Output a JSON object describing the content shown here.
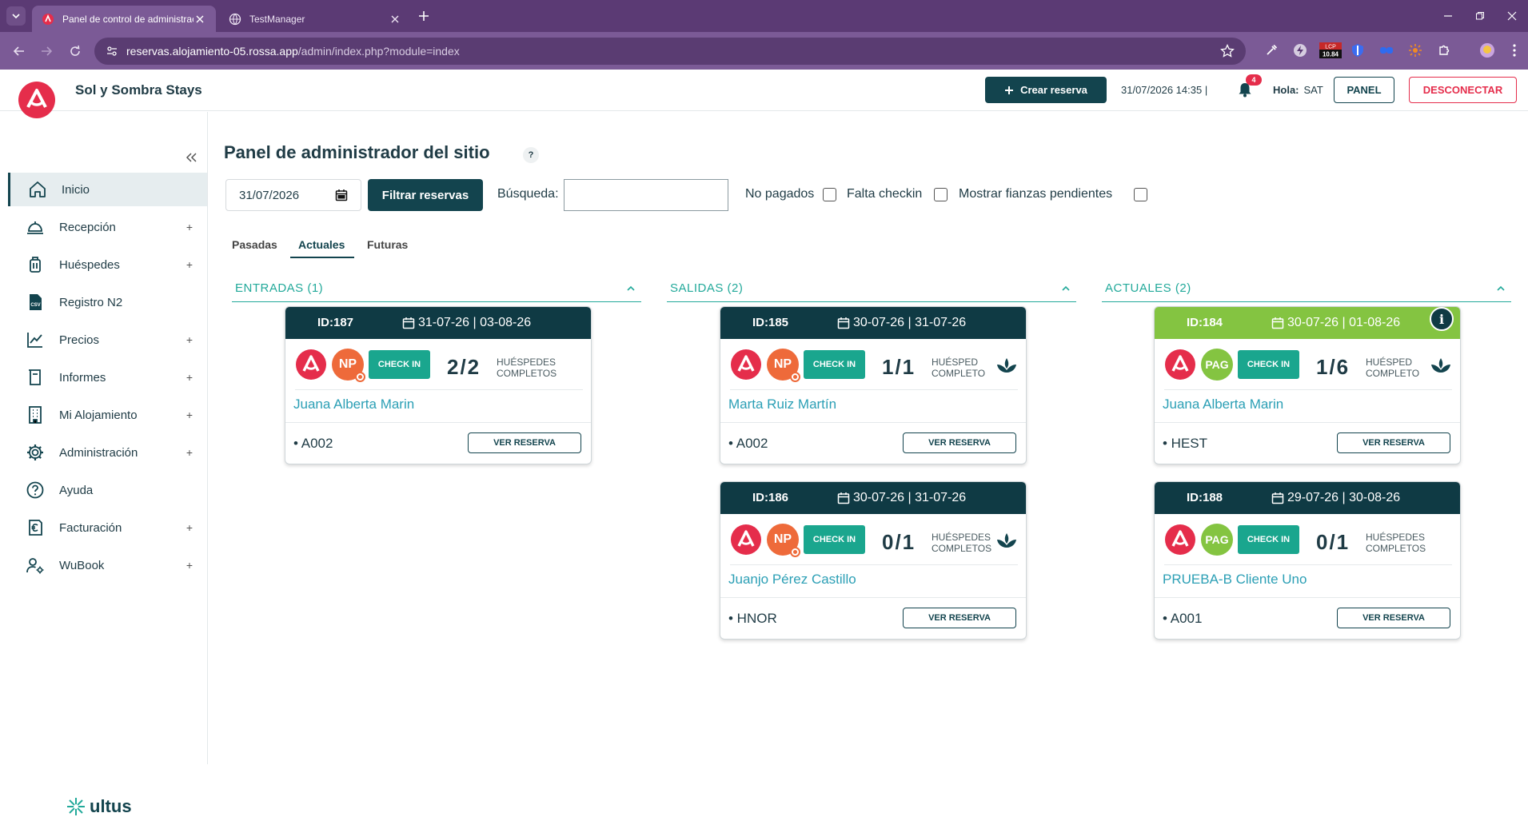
{
  "browser": {
    "tabs": [
      {
        "title": "Panel de control de administrac"
      },
      {
        "title": "TestManager"
      }
    ],
    "url_host": "reservas.alojamiento-05.rossa.app",
    "url_path": "/admin/index.php?module=index",
    "ext_badge": "10.84"
  },
  "header": {
    "brand": "Sol y Sombra Stays",
    "crear_label": "Crear reserva",
    "datetime": "31/07/2026 14:35 |",
    "notif_count": "4",
    "hola_label": "Hola:",
    "user": "SAT",
    "panel_label": "PANEL",
    "logout_label": "DESCONECTAR"
  },
  "sidebar": {
    "items": [
      {
        "label": "Inicio",
        "icon": "home-icon",
        "plus": ""
      },
      {
        "label": "Recepción",
        "icon": "bell-desk-icon",
        "plus": "+"
      },
      {
        "label": "Huéspedes",
        "icon": "luggage-icon",
        "plus": "+"
      },
      {
        "label": "Registro N2",
        "icon": "csv-file-icon",
        "plus": ""
      },
      {
        "label": "Precios",
        "icon": "chart-line-icon",
        "plus": "+"
      },
      {
        "label": "Informes",
        "icon": "document-icon",
        "plus": "+"
      },
      {
        "label": "Mi Alojamiento",
        "icon": "building-icon",
        "plus": "+"
      },
      {
        "label": "Administración",
        "icon": "gear-icon",
        "plus": "+"
      },
      {
        "label": "Ayuda",
        "icon": "question-icon",
        "plus": ""
      },
      {
        "label": "Facturación",
        "icon": "euro-icon",
        "plus": "+"
      },
      {
        "label": "WuBook",
        "icon": "user-gear-icon",
        "plus": "+"
      }
    ],
    "footer_brand": "ultus"
  },
  "main": {
    "title": "Panel de administrador del sitio",
    "help": "?",
    "filter": {
      "date_value": "31/07/2026",
      "filter_button": "Filtrar reservas",
      "search_label": "Búsqueda:",
      "search_value": "",
      "checks": [
        "No pagados",
        "Falta checkin",
        "Mostrar fianzas pendientes"
      ]
    },
    "tabs": [
      "Pasadas",
      "Actuales",
      "Futuras"
    ],
    "active_tab": "Actuales",
    "columns": [
      {
        "title": "ENTRADAS (1)",
        "cards": [
          {
            "id": "ID:187",
            "dates": "31-07-26 | 03-08-26",
            "status": "NP",
            "header_color": "#0f3a44",
            "checkin": "CHECK IN",
            "ratio": "2/2",
            "ratio_label_1": "HUÉSPEDES",
            "ratio_label_2": "COMPLETOS",
            "plant": false,
            "info": false,
            "guest": "Juana Alberta Marin",
            "room": "• A002",
            "ver": "VER RESERVA"
          }
        ]
      },
      {
        "title": "SALIDAS (2)",
        "cards": [
          {
            "id": "ID:185",
            "dates": "30-07-26 | 31-07-26",
            "status": "NP",
            "header_color": "#0f3a44",
            "checkin": "CHECK IN",
            "ratio": "1/1",
            "ratio_label_1": "HUÉSPED",
            "ratio_label_2": "COMPLETO",
            "plant": true,
            "info": false,
            "guest": "Marta Ruiz Martín",
            "room": "• A002",
            "ver": "VER RESERVA"
          },
          {
            "id": "ID:186",
            "dates": "30-07-26 | 31-07-26",
            "status": "NP",
            "header_color": "#0f3a44",
            "checkin": "CHECK IN",
            "ratio": "0/1",
            "ratio_label_1": "HUÉSPEDES",
            "ratio_label_2": "COMPLETOS",
            "plant": true,
            "info": false,
            "guest": "Juanjo Pérez Castillo",
            "room": "• HNOR",
            "ver": "VER RESERVA"
          }
        ]
      },
      {
        "title": "ACTUALES (2)",
        "cards": [
          {
            "id": "ID:184",
            "dates": "30-07-26 | 01-08-26",
            "status": "PAG",
            "header_color": "#84c441",
            "checkin": "CHECK IN",
            "ratio": "1/6",
            "ratio_label_1": "HUÉSPED",
            "ratio_label_2": "COMPLETO",
            "plant": true,
            "info": true,
            "info_label": "i",
            "guest": "Juana Alberta Marin",
            "room": "• HEST",
            "ver": "VER RESERVA"
          },
          {
            "id": "ID:188",
            "dates": "29-07-26 | 30-08-26",
            "status": "PAG",
            "header_color": "#0f3a44",
            "checkin": "CHECK IN",
            "ratio": "0/1",
            "ratio_label_1": "HUÉSPEDES",
            "ratio_label_2": "COMPLETOS",
            "plant": false,
            "info": false,
            "guest": "PRUEBA-B Cliente Uno",
            "room": "• A001",
            "ver": "VER RESERVA"
          }
        ]
      }
    ]
  },
  "colors": {
    "primary": "#13444e",
    "accent": "#e52d4b",
    "teal": "#22a99a",
    "green": "#84c441",
    "orange": "#ee6a3a"
  }
}
